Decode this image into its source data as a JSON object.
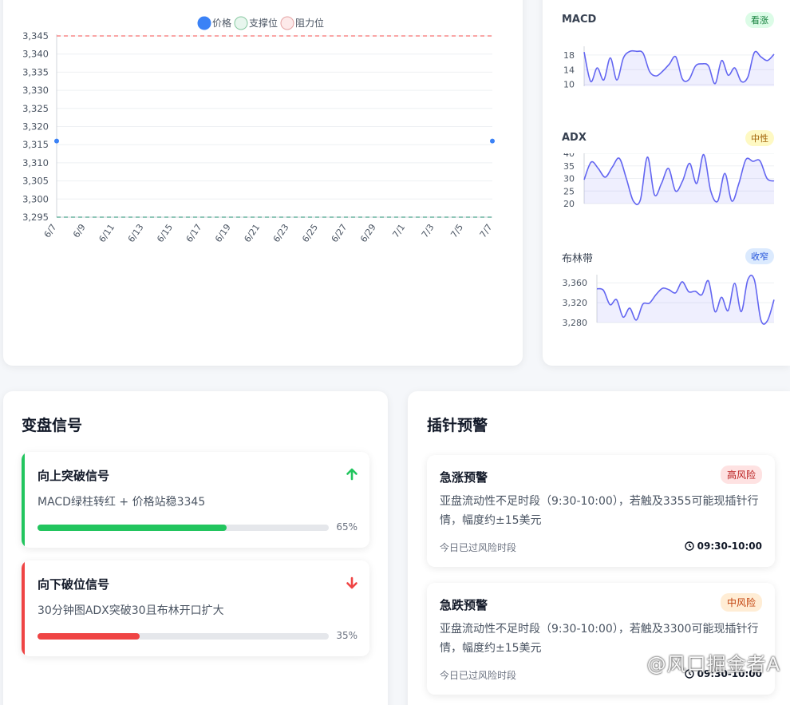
{
  "main_chart": {
    "legend": [
      "价格",
      "支撑位",
      "阻力位"
    ],
    "colors": {
      "price": "#3b82f6",
      "support": "#4ade80",
      "resistance": "#f87171"
    }
  },
  "chart_data": [
    {
      "type": "line",
      "title": "",
      "categories": [
        "6/7",
        "6/9",
        "6/11",
        "6/13",
        "6/15",
        "6/17",
        "6/19",
        "6/21",
        "6/23",
        "6/25",
        "6/27",
        "6/29",
        "7/1",
        "7/3",
        "7/5",
        "7/7"
      ],
      "series": [
        {
          "name": "价格",
          "x": [
            "6/7",
            "7/7"
          ],
          "values": [
            3316,
            3316
          ]
        },
        {
          "name": "支撑位",
          "values": [
            3295,
            3295
          ]
        },
        {
          "name": "阻力位",
          "values": [
            3345,
            3345
          ]
        }
      ],
      "y_ticks": [
        3295,
        3300,
        3305,
        3310,
        3315,
        3320,
        3325,
        3330,
        3335,
        3340,
        3345
      ],
      "ylim": [
        3295,
        3345
      ],
      "grid": true,
      "legend_position": "top"
    },
    {
      "type": "area",
      "title": "MACD",
      "y_ticks": [
        10,
        14,
        18
      ],
      "ylim": [
        9.5,
        19.5
      ],
      "values": [
        18.8,
        10.8,
        14.5,
        11.2,
        17.2,
        11.2,
        17.2,
        19.0,
        19.0,
        18.5,
        13.5,
        12.3,
        13.6,
        15.5,
        17.5,
        11.5,
        11.3,
        15.0,
        15.6,
        15.0,
        10.2,
        16.5,
        12.5,
        14.5,
        10.8,
        12.0,
        18.7,
        17.5,
        16.5,
        18.2
      ]
    },
    {
      "type": "area",
      "title": "ADX",
      "y_ticks": [
        20,
        25,
        30,
        35,
        40
      ],
      "ylim": [
        20,
        40
      ],
      "values": [
        29.5,
        36.5,
        34.0,
        30.5,
        34.5,
        38.0,
        30.0,
        21.0,
        21.5,
        38.5,
        23.5,
        28.0,
        34.0,
        25.0,
        29.0,
        36.0,
        28.0,
        39.5,
        25.0,
        21.0,
        32.0,
        21.0,
        28.0,
        37.5,
        36.8,
        37.0,
        30.0,
        29.0
      ]
    },
    {
      "type": "area",
      "title": "布林带",
      "y_ticks": [
        3280,
        3320,
        3360
      ],
      "ylim": [
        3280,
        3370
      ],
      "values": [
        3348,
        3345,
        3316,
        3326,
        3291,
        3309,
        3285,
        3317,
        3319,
        3336,
        3349,
        3346,
        3340,
        3362,
        3342,
        3343,
        3336,
        3364,
        3302,
        3331,
        3304,
        3359,
        3302,
        3366,
        3366,
        3285,
        3284,
        3326
      ]
    }
  ],
  "indicators": [
    {
      "label": "MACD",
      "badge": "看涨",
      "badge_bg": "#dcfce7",
      "badge_fg": "#15803d"
    },
    {
      "label": "ADX",
      "badge": "中性",
      "badge_bg": "#fef9c3",
      "badge_fg": "#a16207"
    },
    {
      "label": "布林带",
      "badge": "收窄",
      "badge_bg": "#dbeafe",
      "badge_fg": "#1d4ed8"
    }
  ],
  "signals": {
    "title": "变盘信号",
    "items": [
      {
        "title": "向上突破信号",
        "desc": "MACD绿柱转红 + 价格站稳3345",
        "progress": 0.65,
        "pct": "65%",
        "color": "#22c55e",
        "icon": "arrow-up-icon"
      },
      {
        "title": "向下破位信号",
        "desc": "30分钟图ADX突破30且布林开口扩大",
        "progress": 0.35,
        "pct": "35%",
        "color": "#ef4444",
        "icon": "arrow-down-icon"
      }
    ]
  },
  "pins": {
    "title": "插针预警",
    "items": [
      {
        "title": "急涨预警",
        "badge": "高风险",
        "badge_bg": "#fee2e2",
        "badge_fg": "#b91c1c",
        "desc": "亚盘流动性不足时段（9:30-10:00），若触及3355可能现插针行情，幅度约±15美元",
        "status": "今日已过风险时段",
        "time": "09:30-10:00",
        "icon": "clock-icon"
      },
      {
        "title": "急跌预警",
        "badge": "中风险",
        "badge_bg": "#ffedd5",
        "badge_fg": "#c2410c",
        "desc": "亚盘流动性不足时段（9:30-10:00），若触及3300可能现插针行情，幅度约±15美元",
        "status": "今日已过风险时段",
        "time": "09:30-10:00",
        "icon": "clock-icon"
      }
    ]
  },
  "watermark": "@风口掘金者A"
}
